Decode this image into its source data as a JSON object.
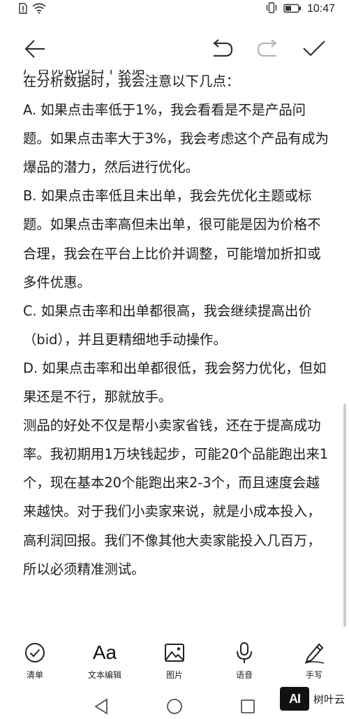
{
  "status_bar": {
    "time": "10:47",
    "icons": [
      "sim-alert-icon",
      "wifi-icon",
      "vibrate-icon",
      "battery-icon"
    ]
  },
  "toolbar": {
    "icons": [
      "back-arrow-icon",
      "undo-icon",
      "redo-icon",
      "checkmark-icon"
    ]
  },
  "document": {
    "cut_line": "广告优化的四个数据",
    "paragraphs": [
      "在分析数据时，我会注意以下几点：",
      "A. 如果点击率低于1%，我会看看是不是产品问题。如果点击率大于3%，我会考虑这个产品有成为爆品的潜力，然后进行优化。",
      "B. 如果点击率低且未出单，我会先优化主题或标题。如果点击率高但未出单，很可能是因为价格不合理，我会在平台上比价并调整，可能增加折扣或多件优惠。",
      "C. 如果点击率和出单都很高，我会继续提高出价（bid），并且更精细地手动操作。",
      "D. 如果点击率和出单都很低，我会努力优化，但如果还是不行，那就放手。",
      "测品的好处不仅是帮小卖家省钱，还在于提高成功率。我初期用1万块钱起步，可能20个品能跑出来1个，现在基本20个能跑出来2-3个，而且速度会越来越快。对于我们小卖家来说，就是小成本投入，高利润回报。我们不像其他大卖家能投入几百万，所以必须精准测试。"
    ]
  },
  "bottom_toolbar": {
    "items": [
      {
        "label": "清单",
        "icon": "checklist-icon"
      },
      {
        "label": "文本编辑",
        "icon": "text-format-icon",
        "glyph": "Aa"
      },
      {
        "label": "图片",
        "icon": "image-icon"
      },
      {
        "label": "语音",
        "icon": "microphone-icon"
      },
      {
        "label": "手写",
        "icon": "handwriting-pen-icon"
      }
    ]
  },
  "nav_bar": {
    "icons": [
      "nav-back-icon",
      "nav-home-icon",
      "nav-recents-icon"
    ]
  },
  "watermark": {
    "logo": "AI",
    "text": "树叶云"
  },
  "colors": {
    "background": "#ffffff",
    "text": "#1d1d1d",
    "icon": "#333333",
    "disabled_icon": "#b5b5b5"
  }
}
